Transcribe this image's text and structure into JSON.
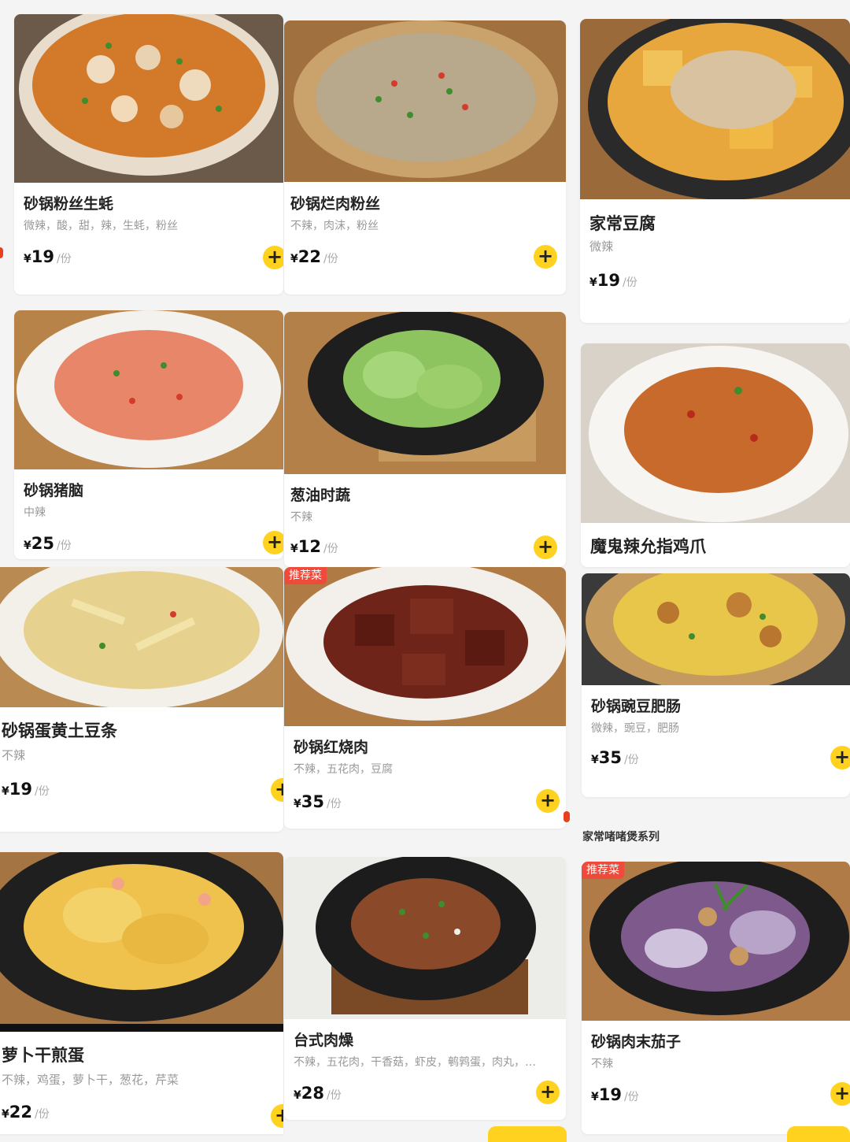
{
  "colors": {
    "accent": "#ffd21f",
    "badge": "#ef4b3c"
  },
  "price_unit": "/份",
  "currency": "¥",
  "add_icon": "+",
  "section": {
    "title": "家常啫啫煲系列"
  },
  "dishes": [
    {
      "name": "砂锅粉丝生蚝",
      "tags": "微辣，酸，甜，辣，生蚝，粉丝",
      "price": "19",
      "badge": ""
    },
    {
      "name": "砂锅烂肉粉丝",
      "tags": "不辣，肉沫，粉丝",
      "price": "22",
      "badge": ""
    },
    {
      "name": "家常豆腐",
      "tags": "微辣",
      "price": "19",
      "badge": ""
    },
    {
      "name": "砂锅猪脑",
      "tags": "中辣",
      "price": "25",
      "badge": ""
    },
    {
      "name": "葱油时蔬",
      "tags": "不辣",
      "price": "12",
      "badge": ""
    },
    {
      "name": "魔鬼辣允指鸡爪",
      "tags": "",
      "price": "",
      "badge": ""
    },
    {
      "name": "砂锅蛋黄土豆条",
      "tags": "不辣",
      "price": "19",
      "badge": ""
    },
    {
      "name": "砂锅红烧肉",
      "tags": "不辣，五花肉，豆腐",
      "price": "35",
      "badge": "推荐菜"
    },
    {
      "name": "砂锅豌豆肥肠",
      "tags": "微辣，豌豆，肥肠",
      "price": "35",
      "badge": ""
    },
    {
      "name": "萝卜干煎蛋",
      "tags": "不辣，鸡蛋，萝卜干，葱花，芹菜",
      "price": "22",
      "badge": ""
    },
    {
      "name": "台式肉燥",
      "tags": "不辣，五花肉，干香菇，虾皮，鹌鹑蛋，肉丸，…",
      "price": "28",
      "badge": ""
    },
    {
      "name": "砂锅肉末茄子",
      "tags": "不辣",
      "price": "19",
      "badge": "推荐菜"
    }
  ]
}
